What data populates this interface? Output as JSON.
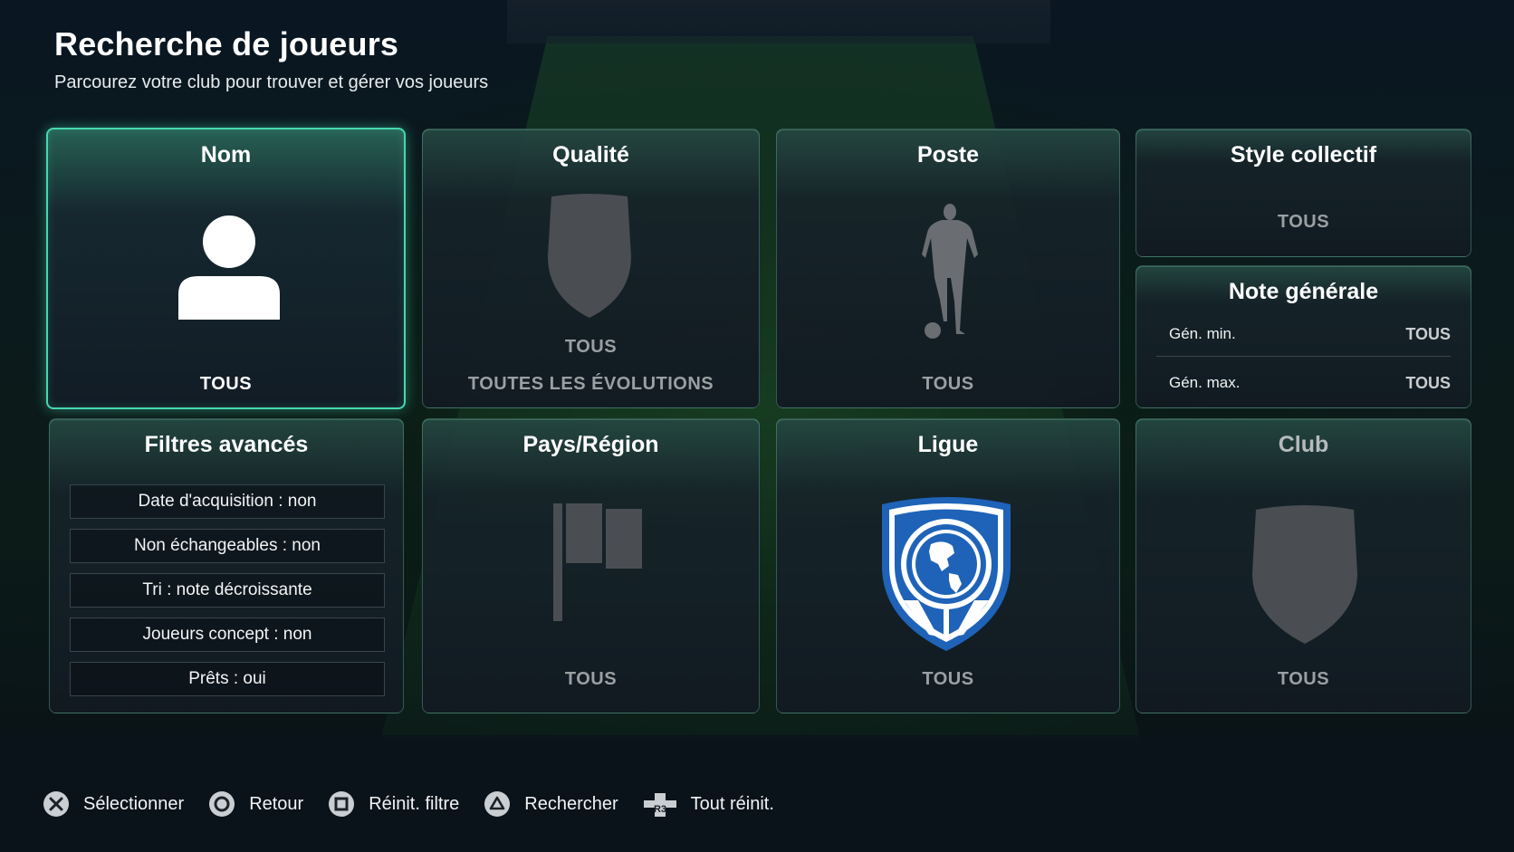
{
  "header": {
    "title": "Recherche de joueurs",
    "subtitle": "Parcourez votre club pour trouver et gérer vos joueurs"
  },
  "tiles": {
    "nom": {
      "title": "Nom",
      "value": "TOUS",
      "icon": "person-icon",
      "selected": true
    },
    "qualite": {
      "title": "Qualité",
      "value": "TOUS",
      "secondary": "TOUTES LES ÉVOLUTIONS",
      "icon": "shield-icon"
    },
    "poste": {
      "title": "Poste",
      "value": "TOUS",
      "icon": "player-silhouette-icon"
    },
    "style": {
      "title": "Style collectif",
      "value": "TOUS"
    },
    "note": {
      "title": "Note générale",
      "rows": [
        {
          "label": "Gén. min.",
          "value": "TOUS"
        },
        {
          "label": "Gén. max.",
          "value": "TOUS"
        }
      ]
    },
    "filtres": {
      "title": "Filtres avancés",
      "items": [
        "Date d'acquisition : non",
        "Non échangeables : non",
        "Tri  : note décroissante",
        "Joueurs concept : non",
        "Prêts : oui"
      ]
    },
    "pays": {
      "title": "Pays/Région",
      "value": "TOUS",
      "icon": "flag-icon"
    },
    "ligue": {
      "title": "Ligue",
      "value": "TOUS",
      "icon": "globe-crest-icon"
    },
    "club": {
      "title": "Club",
      "value": "TOUS",
      "icon": "shield-icon"
    }
  },
  "controls": [
    {
      "icon": "cross-button-icon",
      "label": "Sélectionner"
    },
    {
      "icon": "circle-button-icon",
      "label": "Retour"
    },
    {
      "icon": "square-button-icon",
      "label": "Réinit. filtre"
    },
    {
      "icon": "triangle-button-icon",
      "label": "Rechercher"
    },
    {
      "icon": "r3-button-icon",
      "icon_text": "R3",
      "label": "Tout réinit."
    }
  ],
  "colors": {
    "accent": "#47d8b0",
    "muted_value": "#9aa0a4",
    "crest_blue": "#1e63b8"
  }
}
